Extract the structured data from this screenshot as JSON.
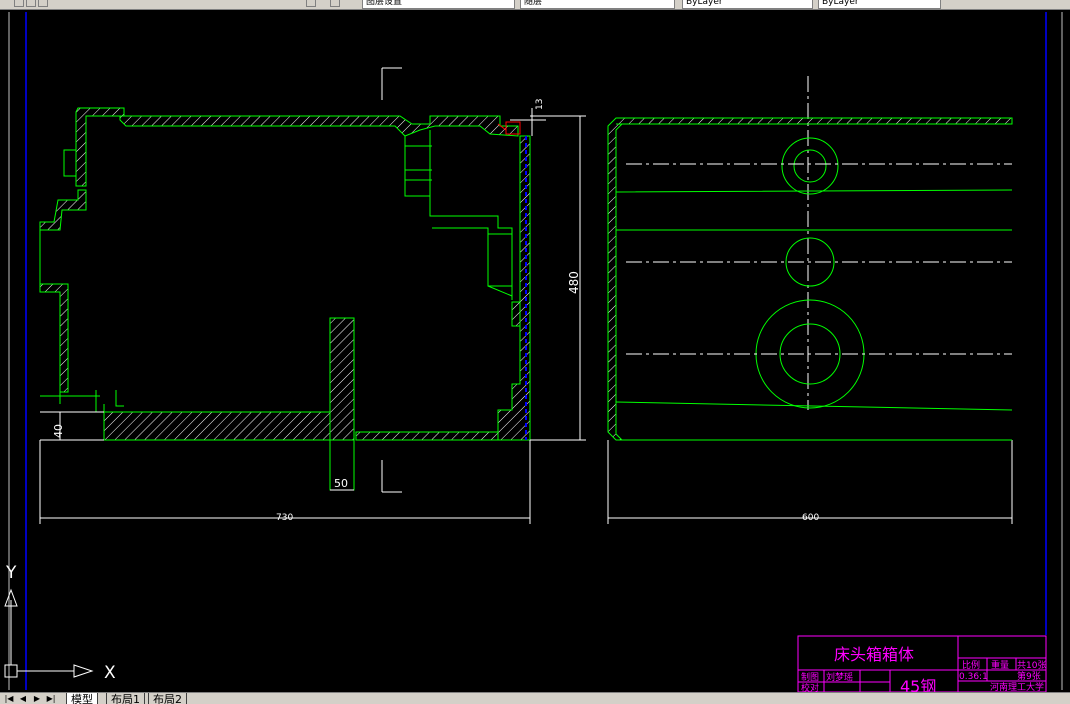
{
  "toolbar": {
    "layer_field": "图层设置",
    "color_field": "随层",
    "linetype_field": "ByLayer",
    "lineweight_field": "ByLayer"
  },
  "drawing": {
    "dimensions": {
      "dim_13": "13",
      "dim_480": "480",
      "dim_40": "40",
      "dim_50": "50",
      "dim_730": "730",
      "dim_600": "600"
    },
    "ucs": {
      "x_label": "X",
      "y_label": "Y"
    },
    "title_block": {
      "part_name": "床头箱箱体",
      "label_scale": "比例",
      "label_weight": "重量",
      "label_total": "共10张",
      "value_scale": "0.36:1",
      "label_sheet": "第9张",
      "label_drawn": "制图",
      "value_drawer": "刘梦瑶",
      "label_checked": "校对",
      "material": "45钢",
      "school": "河南理工大学"
    }
  },
  "tabs": {
    "nav": [
      "|◀",
      "◀",
      "▶",
      "▶|"
    ],
    "items": [
      "模型",
      "布局1",
      "布局2"
    ],
    "active": "模型"
  },
  "colors": {
    "background": "#000000",
    "outline": "#00ff00",
    "dimension": "#ffffff",
    "title_block": "#ff00ff",
    "border": "#0000ff"
  }
}
